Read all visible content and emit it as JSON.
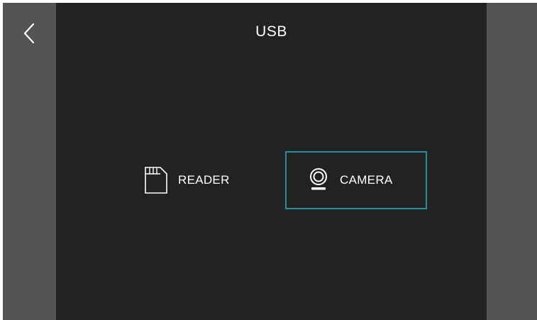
{
  "header": {
    "title": "USB",
    "back_icon": "chevron-left-icon"
  },
  "options": {
    "reader": {
      "label": "READER",
      "icon": "sd-card-icon",
      "selected": false
    },
    "camera": {
      "label": "CAMERA",
      "icon": "webcam-icon",
      "selected": true
    }
  },
  "colors": {
    "content_background": "#222222",
    "side_rail": "#545454",
    "selection_border": "#22909a",
    "text": "#ffffff"
  }
}
